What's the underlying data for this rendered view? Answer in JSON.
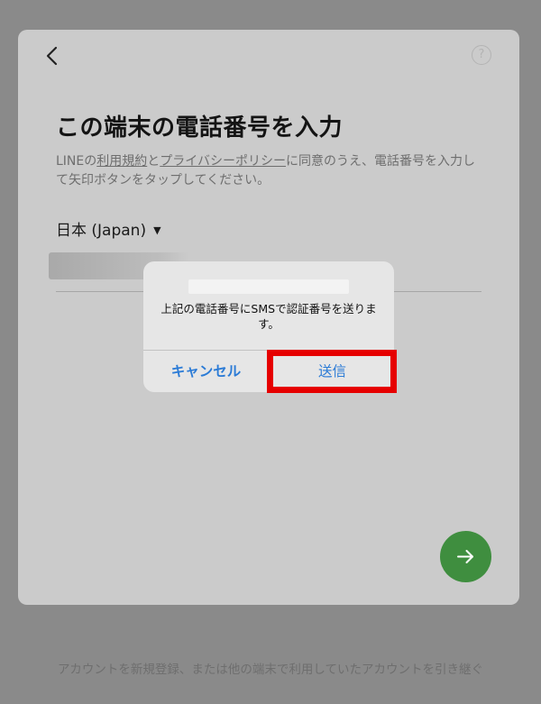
{
  "header": {
    "back_icon": "chevron-left-icon",
    "help_label": "?"
  },
  "main": {
    "title": "この端末の電話番号を入力",
    "desc_prefix": "LINEの",
    "terms_link": "利用規約",
    "desc_and": "と",
    "privacy_link": "プライバシーポリシー",
    "desc_suffix": "に同意のうえ、電話番号を入力して矢印ボタンをタップしてください。",
    "country": "日本 (Japan)",
    "country_caret": "▼",
    "next_icon": "arrow-right-icon"
  },
  "dialog": {
    "message": "上記の電話番号にSMSで認証番号を送ります。",
    "cancel_label": "キャンセル",
    "send_label": "送信"
  },
  "footer": {
    "text": "アカウントを新規登録、または他の端末で利用していたアカウントを引き継ぐ"
  },
  "colors": {
    "accent_green": "#3f8e3f",
    "link_blue": "#2b7bd6",
    "highlight_red": "#e60000"
  }
}
